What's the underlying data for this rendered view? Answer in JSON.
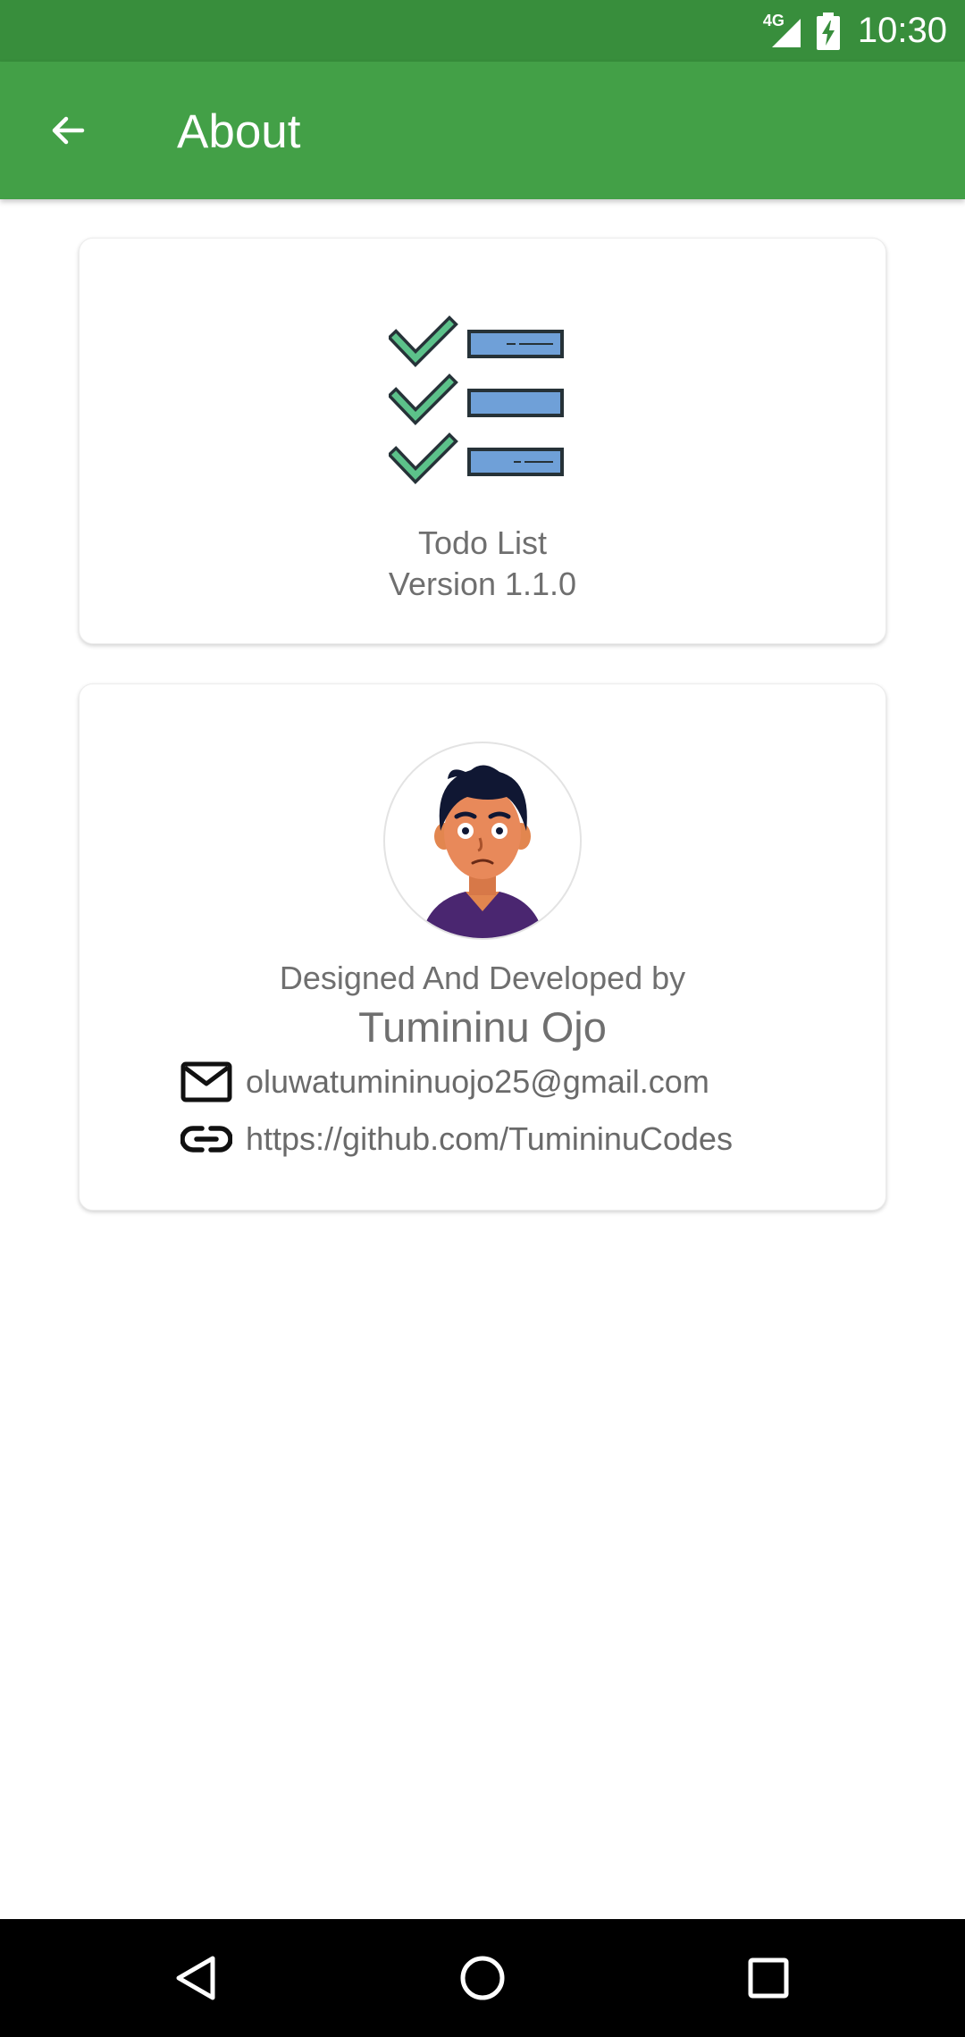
{
  "status_bar": {
    "network": "4G",
    "time": "10:30",
    "icons": [
      "signal-icon",
      "battery-charging-icon"
    ]
  },
  "app_bar": {
    "title": "About",
    "back_icon": "arrow-back-icon",
    "background": "#43a047",
    "status_background": "#388e3c"
  },
  "app_card": {
    "logo_icon": "todo-checklist-logo",
    "name": "Todo List",
    "version": "Version 1.1.0"
  },
  "developer_card": {
    "avatar_icon": "developer-avatar",
    "credit_label": "Designed And Developed by",
    "name": "Tumininu Ojo",
    "email": "oluwatumininuojo25@gmail.com",
    "email_icon": "mail-icon",
    "link": "https://github.com/TumininuCodes",
    "link_icon": "link-icon"
  },
  "nav_bar": {
    "buttons": [
      "nav-back-icon",
      "nav-home-icon",
      "nav-recents-icon"
    ]
  }
}
